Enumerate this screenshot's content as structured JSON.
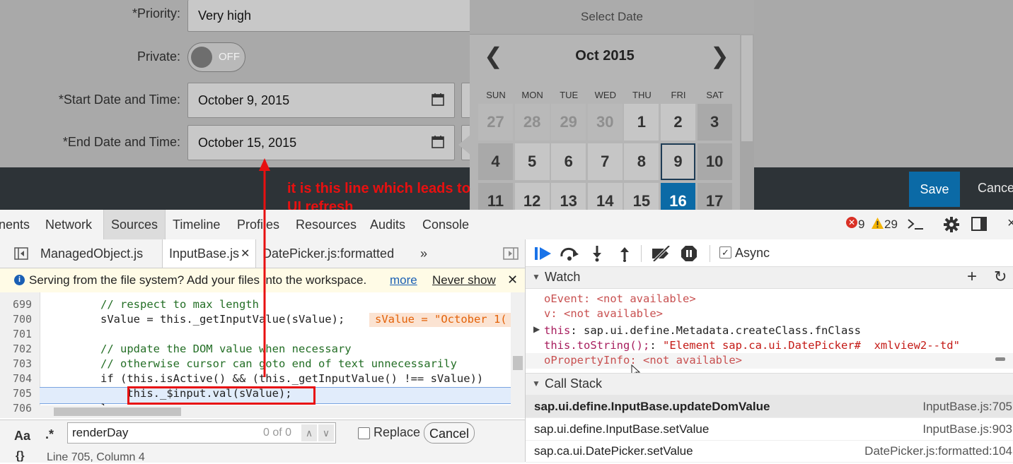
{
  "form": {
    "priority_label": "Priority:",
    "priority_value": "Very high",
    "private_label": "Private:",
    "private_toggle": "OFF",
    "start_label": "Start Date and Time:",
    "start_value": "October 9, 2015",
    "end_label": "End Date and Time:",
    "end_value": "October 15, 2015",
    "required_mark": "*",
    "save": "Save",
    "cancel": "Cance"
  },
  "datepicker": {
    "title": "Select Date",
    "month": "Oct 2015",
    "prev": "❮",
    "next": "❯",
    "weekdays": [
      "SUN",
      "MON",
      "TUE",
      "WED",
      "THU",
      "FRI",
      "SAT"
    ],
    "rows": [
      [
        "27",
        "28",
        "29",
        "30",
        "1",
        "2",
        "3"
      ],
      [
        "4",
        "5",
        "6",
        "7",
        "8",
        "9",
        "10"
      ],
      [
        "11",
        "12",
        "13",
        "14",
        "15",
        "16",
        "17"
      ]
    ]
  },
  "annotation": {
    "line1": "it is this line which leads to",
    "line2": "UI refresh"
  },
  "devtools": {
    "tabs": [
      "nents",
      "Network",
      "Sources",
      "Timeline",
      "Profiles",
      "Resources",
      "Audits",
      "Console"
    ],
    "errors": "9",
    "warnings": "29",
    "files": [
      "ManagedObject.js",
      "InputBase.js",
      "DatePicker.js:formatted"
    ],
    "more_tabs": "»",
    "info_text": "Serving from the file system? Add your files into the workspace.",
    "info_more": "more",
    "info_never": "Never show",
    "lines": [
      {
        "n": "699",
        "t": "// respect to max length"
      },
      {
        "n": "700",
        "t": "sValue = this._getInputValue(sValue);"
      },
      {
        "n": "701",
        "t": ""
      },
      {
        "n": "702",
        "t": "// update the DOM value when necessary"
      },
      {
        "n": "703",
        "t": "// otherwise cursor can goto end of text unnecessarily"
      },
      {
        "n": "704",
        "t": "if (this.isActive() && (this._getInputValue() !== sValue))"
      },
      {
        "n": "705",
        "t": "    this._$input.val(sValue);"
      },
      {
        "n": "706",
        "t": "}"
      }
    ],
    "inline_value": "sValue = \"October 1(",
    "search_aa": "Aa",
    "search_regex": ".*",
    "search_value": "renderDay",
    "search_count": "0 of 0",
    "replace_label": "Replace",
    "cancel_label": "Cancel",
    "status": "Line 705, Column 4",
    "braces": "{}",
    "async_label": "Async",
    "watch_title": "Watch",
    "watch": [
      {
        "k": "oEvent",
        "v": "<not available>"
      },
      {
        "k": "v",
        "v": "<not available>"
      },
      {
        "k": "this",
        "v": "sap.ui.define.Metadata.createClass.fnClass"
      },
      {
        "k": "this.toString();",
        "v": "\"Element sap.ca.ui.DatePicker#  xmlview2--td\""
      },
      {
        "k": "oPropertyInfo",
        "v": "<not available>"
      }
    ],
    "callstack_title": "Call Stack",
    "callstack": [
      {
        "fn": "sap.ui.define.InputBase.updateDomValue",
        "loc": "InputBase.js:705"
      },
      {
        "fn": "sap.ui.define.InputBase.setValue",
        "loc": "InputBase.js:903"
      },
      {
        "fn": "sap.ca.ui.DatePicker.setValue",
        "loc": "DatePicker.js:formatted:104"
      }
    ]
  }
}
